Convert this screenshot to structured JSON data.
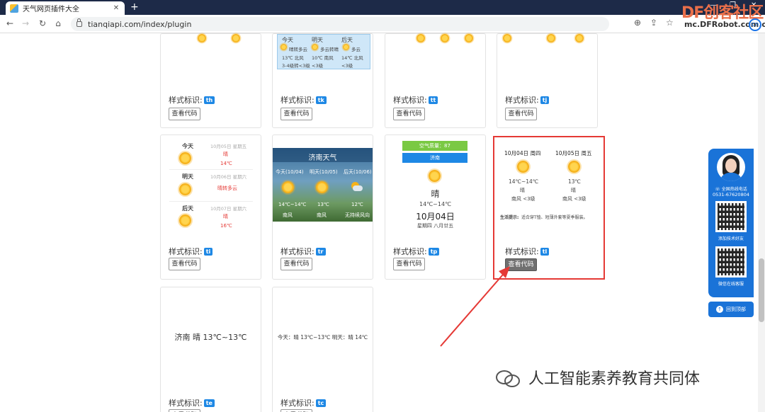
{
  "browser": {
    "tab_title": "天气网页插件大全",
    "tab_close": "✕",
    "new_tab": "+",
    "url": "tianqiapi.com/index/plugin",
    "watermark": "DF创客社区",
    "watermark_sub": "mc.DFRobot.com.cn"
  },
  "cards": {
    "label_prefix": "样式标识:",
    "code_button": "查看代码",
    "row1": [
      {
        "badge": "th"
      },
      {
        "badge": "tk"
      },
      {
        "badge": "tt"
      },
      {
        "badge": "tj"
      }
    ],
    "row2": [
      {
        "badge": "ti"
      },
      {
        "badge": "tr"
      },
      {
        "badge": "tp"
      },
      {
        "badge": "tl"
      }
    ],
    "row3": [
      {
        "badge": "te",
        "line": "济南 晴 13℃~13℃"
      },
      {
        "badge": "tc",
        "line": "今天：晴 13℃~13℃  明天：晴 14℃"
      }
    ]
  },
  "card_tk": {
    "headers": [
      "今天",
      "明天",
      "后天"
    ],
    "cond": [
      "晴转多云",
      "多云转晴",
      "多云"
    ],
    "wind": [
      "13℃ 北风",
      "10℃ 南风",
      "14℃ 北风"
    ],
    "level": [
      "3-4级转<3级",
      "<3级",
      "<3级"
    ]
  },
  "card_ti": {
    "days": [
      {
        "label": "今天",
        "date": "10月05日 星期五",
        "cond": "晴",
        "temp": "14℃"
      },
      {
        "label": "明天",
        "date": "10月06日 星期六",
        "cond": "晴转多云",
        "temp": ""
      },
      {
        "label": "后天",
        "date": "10月07日 星期六",
        "cond": "晴",
        "temp": "16℃"
      }
    ]
  },
  "card_tr": {
    "title": "济南天气",
    "days": [
      {
        "label": "今天(10/04)",
        "temp": "14℃~14℃",
        "wind": "南风"
      },
      {
        "label": "明天(10/05)",
        "temp": "13℃",
        "wind": "南风"
      },
      {
        "label": "后天(10/06)",
        "temp": "12℃",
        "wind": "无持续风向"
      }
    ]
  },
  "card_tp": {
    "aqi": "空气质量：87",
    "city": "济南",
    "cond": "晴",
    "temp": "14℃~14℃",
    "date": "10月04日",
    "lunar": "星期四 八月廿五"
  },
  "card_tl": {
    "days": [
      {
        "date": "10月04日 周四",
        "temp": "14℃~14℃",
        "cond": "晴",
        "wind": "南风 <3级"
      },
      {
        "date": "10月05日 周五",
        "temp": "13℃",
        "cond": "晴",
        "wind": "南风 <3级"
      }
    ],
    "tip_label": "生活提示:",
    "tip": "适合穿T恤、短薄外套等夏季服装。"
  },
  "side_panel": {
    "hotline_label": "全国热线电话",
    "hotline": "0531-67620804",
    "add_friend": "添加技术好友",
    "wechat_service": "微信在线客服",
    "back_top": "回到顶部"
  },
  "footer": {
    "wechat_account": "人工智能素养教育共同体"
  },
  "colors": {
    "badge": "#1e88e5",
    "highlight": "#e53935",
    "panel": "#1a73d8",
    "aqi_green": "#7ac943",
    "aqi_blue": "#1e88e5"
  }
}
